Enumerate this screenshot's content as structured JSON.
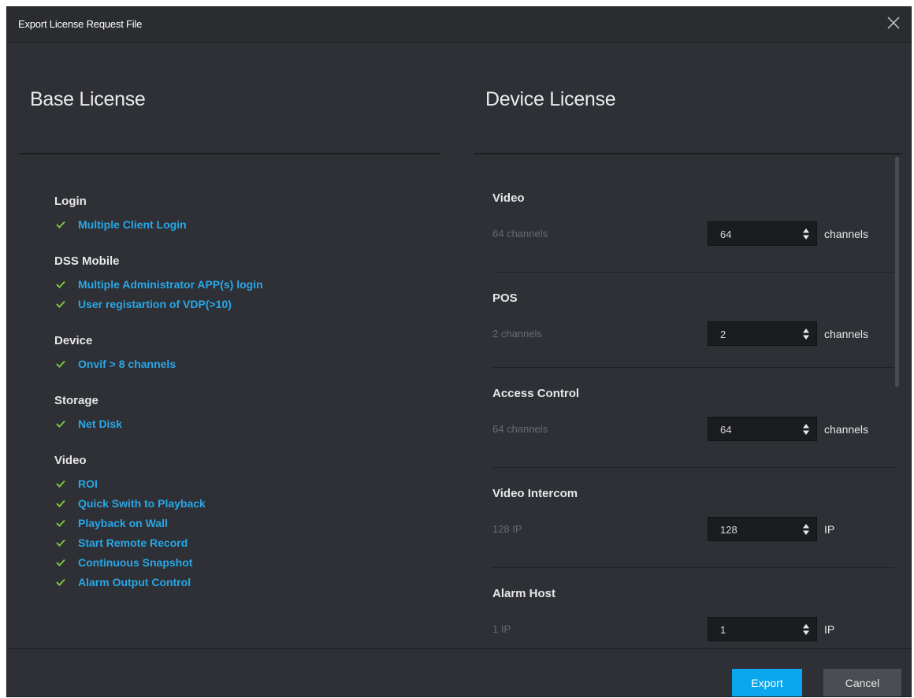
{
  "window": {
    "title": "Export License Request File"
  },
  "base_license": {
    "heading": "Base License",
    "groups": [
      {
        "title": "Login",
        "items": [
          "Multiple Client Login"
        ]
      },
      {
        "title": "DSS Mobile",
        "items": [
          "Multiple Administrator APP(s) login",
          "User registartion of VDP(>10)"
        ]
      },
      {
        "title": "Device",
        "items": [
          "Onvif > 8 channels"
        ]
      },
      {
        "title": "Storage",
        "items": [
          "Net Disk"
        ]
      },
      {
        "title": "Video",
        "items": [
          "ROI",
          "Quick Swith to Playback",
          "Playback on Wall",
          "Start Remote Record",
          "Continuous Snapshot",
          "Alarm Output Control"
        ]
      }
    ]
  },
  "device_license": {
    "heading": "Device License",
    "items": [
      {
        "name": "Video",
        "info": "64 channels",
        "value": "64",
        "unit": "channels"
      },
      {
        "name": "POS",
        "info": "2 channels",
        "value": "2",
        "unit": "channels"
      },
      {
        "name": "Access Control",
        "info": "64 channels",
        "value": "64",
        "unit": "channels"
      },
      {
        "name": "Video Intercom",
        "info": "128 IP",
        "value": "128",
        "unit": "IP"
      },
      {
        "name": "Alarm Host",
        "info": "1 IP",
        "value": "1",
        "unit": "IP"
      }
    ]
  },
  "footer": {
    "export_label": "Export",
    "cancel_label": "Cancel"
  },
  "icons": {
    "check": "check-icon",
    "close": "close-icon",
    "spinner": "up-down-arrows-icon"
  },
  "colors": {
    "accent": "#0aa6ee",
    "link": "#28a8e8",
    "check": "#7ec242",
    "background": "#2e3035"
  }
}
